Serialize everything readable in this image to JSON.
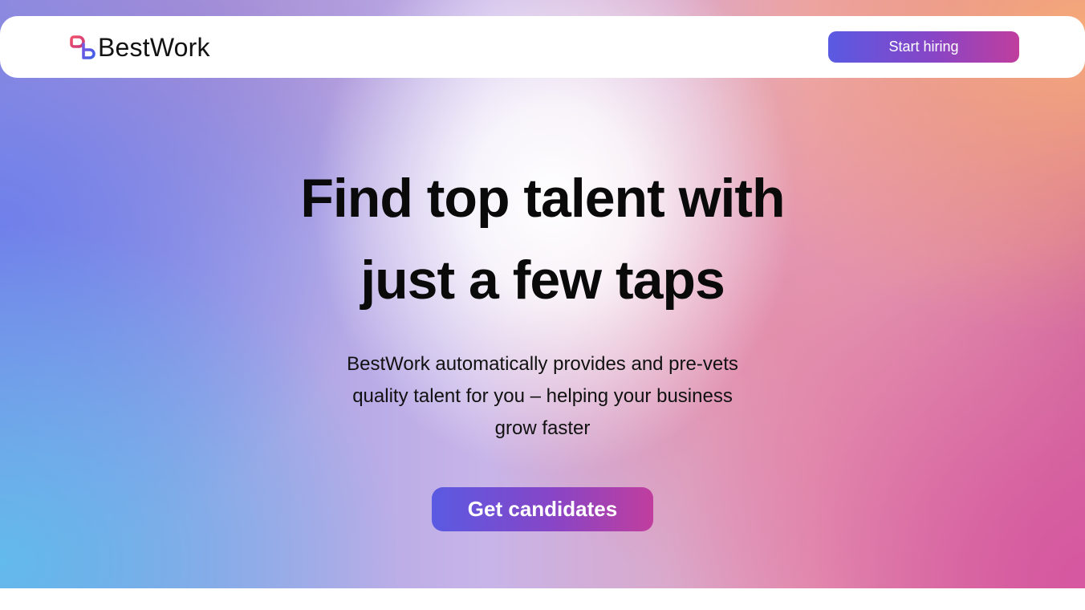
{
  "brand": {
    "name": "BestWork",
    "logo_icon": "bestwork-logo-icon"
  },
  "nav": {
    "cta_label": "Start hiring"
  },
  "hero": {
    "headline_lines": [
      "Find top talent with",
      "just a few taps"
    ],
    "subtext_lines": [
      "BestWork automatically provides and pre-vets",
      "quality talent for you – helping your business",
      "grow faster"
    ],
    "cta_label": "Get candidates"
  },
  "colors": {
    "button_gradient_start": "#5a5ae2",
    "button_gradient_end": "#c03e9e",
    "logo_red": "#e44a5c",
    "logo_blue": "#4f5de0",
    "text_dark": "#0a0a0a"
  }
}
